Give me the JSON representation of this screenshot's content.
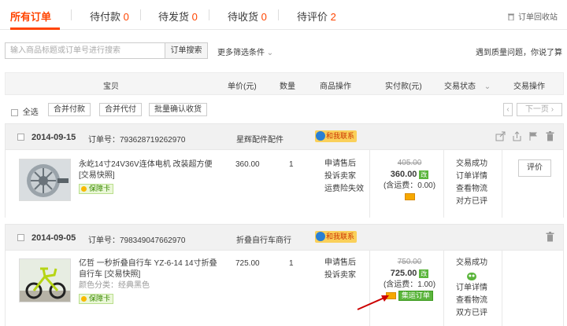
{
  "tabs": [
    {
      "label": "所有订单",
      "count": ""
    },
    {
      "label": "待付款",
      "count": "0"
    },
    {
      "label": "待发货",
      "count": "0"
    },
    {
      "label": "待收货",
      "count": "0"
    },
    {
      "label": "待评价",
      "count": "2"
    }
  ],
  "recycle_label": "订单回收站",
  "search": {
    "placeholder": "输入商品标题或订单号进行搜索",
    "button": "订单搜索"
  },
  "more_filters": "更多筛选条件",
  "quality_notice": "遇到质量问题，你说了算",
  "columns": [
    "宝贝",
    "单价(元)",
    "数量",
    "商品操作",
    "实付款(元)",
    "交易状态",
    "交易操作"
  ],
  "batch": {
    "select_all": "全选",
    "merge_pay": "合并付款",
    "merge_proxy": "合并代付",
    "batch_confirm": "批量确认收货",
    "next_page": "下一页"
  },
  "orders": [
    {
      "date": "2014-09-15",
      "order_no_label": "订单号：",
      "order_no": "793628719262970",
      "shop": "星辉配件配件",
      "contact": "和我联系",
      "product": "永屹14寸24V36V连体电机 改装超方便",
      "snapshot": "[交易快照]",
      "guarantee": "保障卡",
      "unit_price": "360.00",
      "quantity": "1",
      "product_ops": [
        "申请售后",
        "投诉卖家",
        "运费险失效"
      ],
      "original_price": "405.00",
      "paid": "360.00",
      "shipping": "(含运费：0.00)",
      "status": [
        "交易成功",
        "订单详情",
        "查看物流",
        "对方已评"
      ],
      "action": "评价"
    },
    {
      "date": "2014-09-05",
      "order_no_label": "订单号：",
      "order_no": "798349047662970",
      "shop": "折叠自行车商行",
      "contact": "和我联系",
      "product": "亿哲 一秒折叠自行车 YZ-6-14 14寸折叠自行车",
      "snapshot": "[交易快照]",
      "variant": "颜色分类：经典黑色",
      "guarantee": "保障卡",
      "unit_price": "725.00",
      "quantity": "1",
      "product_ops": [
        "申请售后",
        "投诉卖家"
      ],
      "original_price": "750.00",
      "paid": "725.00",
      "shipping": "(含运费：1.00)",
      "consolidated_tag": "集运订单",
      "status": [
        "交易成功",
        "订单详情",
        "查看物流",
        "双方已评"
      ]
    }
  ],
  "paid_badge": "改",
  "colors": {
    "accent": "#ff4400",
    "count": "#ff4400",
    "header_bg": "#f5f5f5"
  }
}
